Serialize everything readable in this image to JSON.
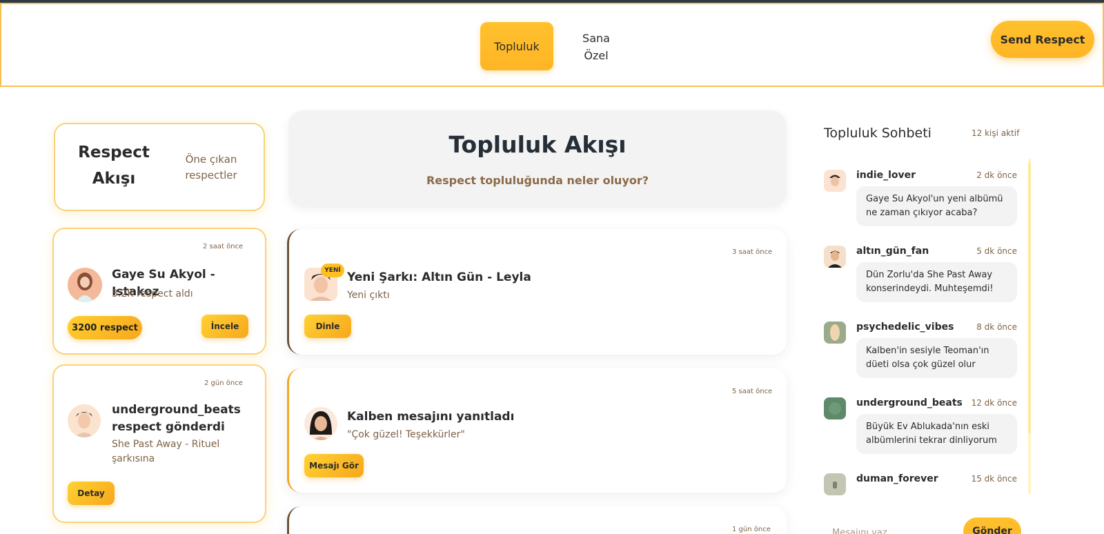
{
  "nav": {
    "tabs": [
      {
        "label": "Topluluk",
        "active": true
      },
      {
        "label": "Sana Özel",
        "active": false
      }
    ],
    "send_respect": "Send Respect"
  },
  "left": {
    "header": {
      "title": "Respect Akışı",
      "subtitle": "Öne çıkan respectler"
    },
    "cards": [
      {
        "time": "2 saat önce",
        "title": "Gaye Su Akyol - Istakoz",
        "subtitle": "3.2K respect aldı",
        "pill": "3200 respect",
        "button": "İncele"
      },
      {
        "time": "2 gün önce",
        "title": "underground_beats respect gönderdi",
        "subtitle": "She Past Away - Rituel şarkısına",
        "button": "Detay"
      }
    ]
  },
  "feed": {
    "title": "Topluluk Akışı",
    "subtitle": "Respect topluluğunda neler oluyor?",
    "items": [
      {
        "time": "3 saat önce",
        "badge": "YENİ",
        "title": "Yeni Şarkı: Altın Gün - Leyla",
        "subtitle": "Yeni çıktı",
        "button": "Dinle"
      },
      {
        "time": "5 saat önce",
        "title": "Kalben mesajını yanıtladı",
        "subtitle": "\"Çok güzel! Teşekkürler\"",
        "button": "Mesajı Gör"
      },
      {
        "time": "1 gün önce"
      }
    ]
  },
  "chat": {
    "title": "Topluluk Sohbeti",
    "active": "12 kişi aktif",
    "messages": [
      {
        "user": "indie_lover",
        "time": "2 dk önce",
        "text": "Gaye Su Akyol'un yeni albümü ne zaman çıkıyor acaba?"
      },
      {
        "user": "altın_gün_fan",
        "time": "5 dk önce",
        "text": "Dün Zorlu'da She Past Away konserindeydi. Muhteşemdi!"
      },
      {
        "user": "psychedelic_vibes",
        "time": "8 dk önce",
        "text": "Kalben'in sesiyle Teoman'ın düeti olsa çok güzel olur"
      },
      {
        "user": "underground_beats",
        "time": "12 dk önce",
        "text": "Büyük Ev Ablukada'nın eski albümlerini tekrar dinliyorum"
      },
      {
        "user": "duman_forever",
        "time": "15 dk önce",
        "text": ""
      }
    ],
    "input_placeholder": "Mesajını yaz...",
    "send": "Gönder"
  }
}
